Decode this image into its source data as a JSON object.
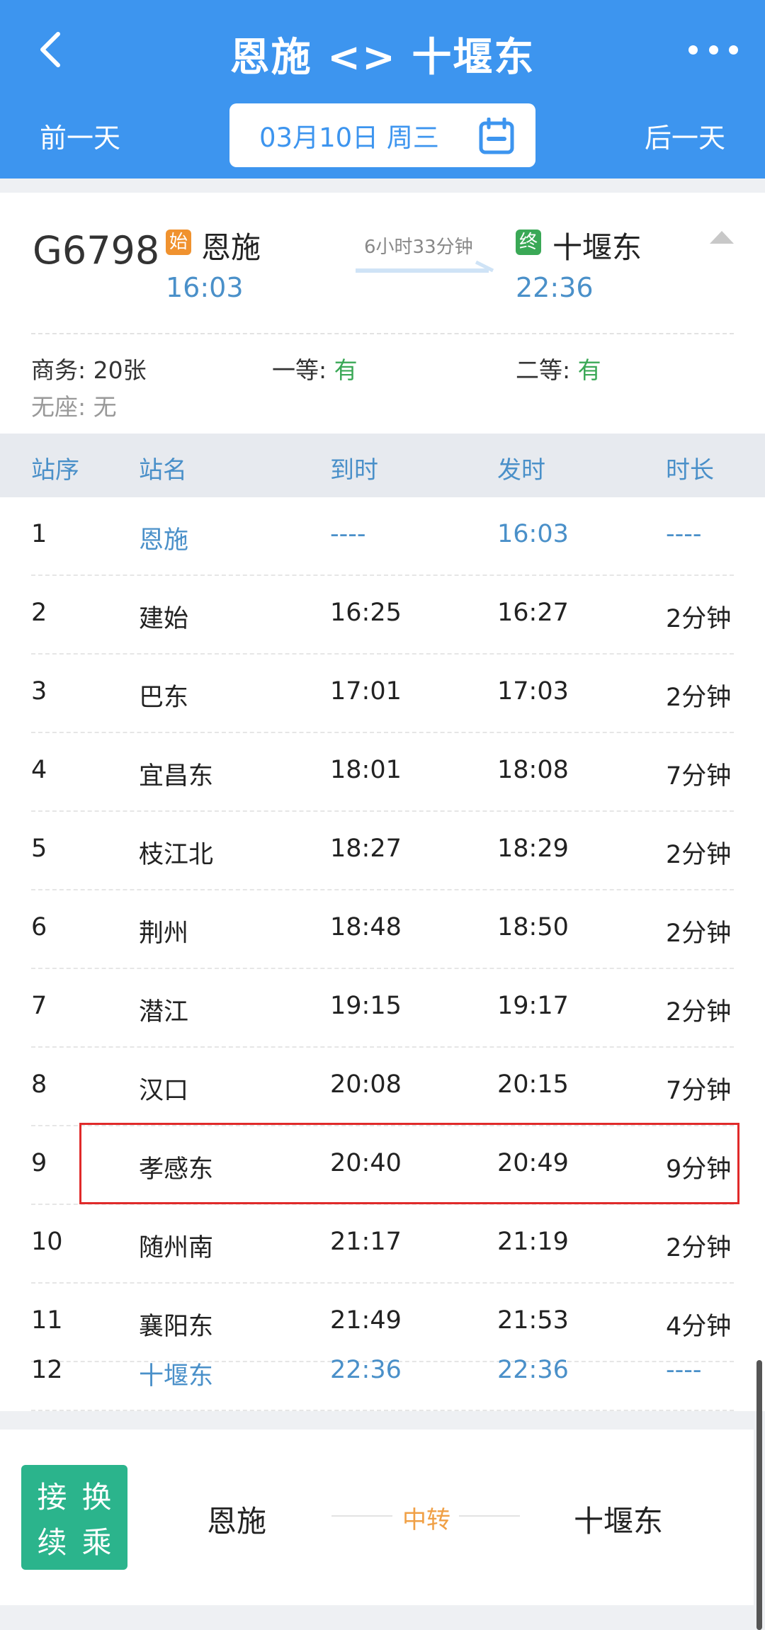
{
  "header": {
    "title": "恩施 <> 十堰东",
    "prev_day": "前一天",
    "next_day": "后一天",
    "date": "03月10日 周三",
    "colors": {
      "primary": "#3d95ef"
    },
    "icons": [
      "back-arrow-icon",
      "more-dots-icon",
      "calendar-icon"
    ]
  },
  "train": {
    "number": "G6798",
    "start_badge": "始",
    "end_badge": "终",
    "from": "恩施",
    "from_time": "16:03",
    "to": "十堰东",
    "to_time": "22:36",
    "duration": "6小时33分钟"
  },
  "seats": {
    "business_label": "商务:",
    "business_value": "20张",
    "first_label": "一等:",
    "first_value": "有",
    "second_label": "二等:",
    "second_value": "有",
    "standing_label": "无座:",
    "standing_value": "无"
  },
  "table": {
    "headers": [
      "站序",
      "站名",
      "到时",
      "发时",
      "时长"
    ],
    "rows": [
      [
        "1",
        "恩施",
        "----",
        "16:03",
        "----"
      ],
      [
        "2",
        "建始",
        "16:25",
        "16:27",
        "2分钟"
      ],
      [
        "3",
        "巴东",
        "17:01",
        "17:03",
        "2分钟"
      ],
      [
        "4",
        "宜昌东",
        "18:01",
        "18:08",
        "7分钟"
      ],
      [
        "5",
        "枝江北",
        "18:27",
        "18:29",
        "2分钟"
      ],
      [
        "6",
        "荆州",
        "18:48",
        "18:50",
        "2分钟"
      ],
      [
        "7",
        "潜江",
        "19:15",
        "19:17",
        "2分钟"
      ],
      [
        "8",
        "汉口",
        "20:08",
        "20:15",
        "7分钟"
      ],
      [
        "9",
        "孝感东",
        "20:40",
        "20:49",
        "9分钟"
      ],
      [
        "10",
        "随州南",
        "21:17",
        "21:19",
        "2分钟"
      ],
      [
        "11",
        "襄阳东",
        "21:49",
        "21:53",
        "4分钟"
      ],
      [
        "12",
        "十堰东",
        "22:36",
        "22:36",
        "----"
      ]
    ],
    "highlighted_row": "9"
  },
  "transfer": {
    "button_chars": [
      "接",
      "换",
      "续",
      "乘"
    ],
    "from": "恩施",
    "middle": "中转",
    "to": "十堰东"
  }
}
